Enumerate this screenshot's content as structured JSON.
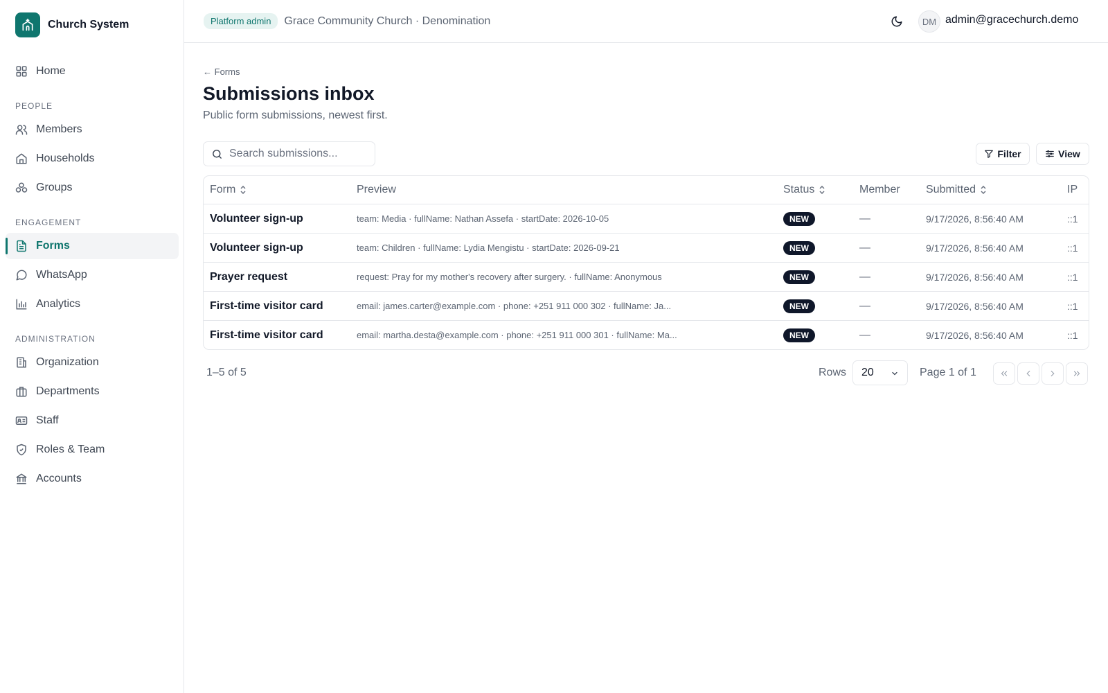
{
  "brand": {
    "name": "Church System",
    "icon": "church-icon"
  },
  "nav": {
    "home": "Home",
    "sections": {
      "people": "PEOPLE",
      "engagement": "ENGAGEMENT",
      "administration": "ADMINISTRATION"
    },
    "members": "Members",
    "households": "Households",
    "groups": "Groups",
    "forms": "Forms",
    "whatsapp": "WhatsApp",
    "analytics": "Analytics",
    "organization": "Organization",
    "departments": "Departments",
    "staff": "Staff",
    "roles": "Roles & Team",
    "accounts": "Accounts",
    "active": "Forms"
  },
  "topbar": {
    "badge": "Platform admin",
    "org": "Grace Community Church · Denomination",
    "avatar": "DM",
    "user": "admin@gracechurch.demo"
  },
  "page": {
    "back": "Forms",
    "title": "Submissions inbox",
    "subtitle": "Public form submissions, newest first."
  },
  "search": {
    "placeholder": "Search submissions..."
  },
  "toolbar": {
    "filter": "Filter",
    "view": "View"
  },
  "table": {
    "headers": {
      "form": "Form",
      "preview": "Preview",
      "status": "Status",
      "member": "Member",
      "submitted": "Submitted",
      "ip": "IP"
    },
    "rows": [
      {
        "form": "Volunteer sign-up",
        "preview": "team: Media · fullName: Nathan Assefa · startDate: 2026-10-05",
        "status": "NEW",
        "member": "—",
        "submitted": "9/17/2026, 8:56:40 AM",
        "ip": "::1"
      },
      {
        "form": "Volunteer sign-up",
        "preview": "team: Children · fullName: Lydia Mengistu · startDate: 2026-09-21",
        "status": "NEW",
        "member": "—",
        "submitted": "9/17/2026, 8:56:40 AM",
        "ip": "::1"
      },
      {
        "form": "Prayer request",
        "preview": "request: Pray for my mother's recovery after surgery. · fullName: Anonymous",
        "status": "NEW",
        "member": "—",
        "submitted": "9/17/2026, 8:56:40 AM",
        "ip": "::1"
      },
      {
        "form": "First-time visitor card",
        "preview": "email: james.carter@example.com · phone: +251 911 000 302 · fullName: Ja...",
        "status": "NEW",
        "member": "—",
        "submitted": "9/17/2026, 8:56:40 AM",
        "ip": "::1"
      },
      {
        "form": "First-time visitor card",
        "preview": "email: martha.desta@example.com · phone: +251 911 000 301 · fullName: Ma...",
        "status": "NEW",
        "member": "—",
        "submitted": "9/17/2026, 8:56:40 AM",
        "ip": "::1"
      }
    ]
  },
  "pagination": {
    "count": "1–5 of 5",
    "rows_label": "Rows",
    "rows_value": "20",
    "page_info": "Page 1 of 1"
  },
  "colors": {
    "accent": "#0f766e",
    "badge_bg": "#0f172a",
    "border": "#e5e7eb"
  }
}
